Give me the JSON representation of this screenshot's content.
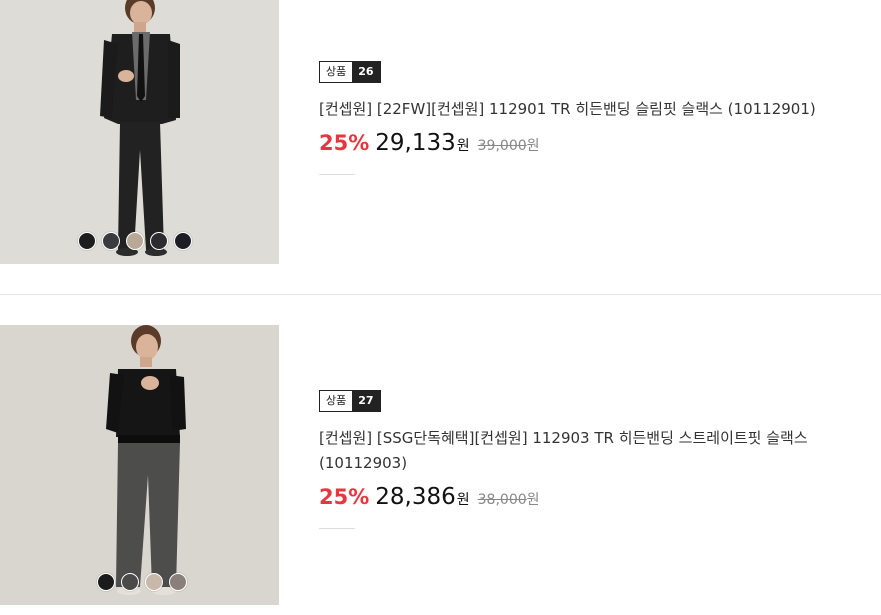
{
  "products": [
    {
      "badge_label": "상품",
      "badge_num": "26",
      "title": "[컨셉원] [22FW][컨셉원] 112901 TR 히든밴딩 슬림핏 슬랙스 (10112901)",
      "discount": "25%",
      "price": "29,133",
      "price_unit": "원",
      "original_price": "39,000",
      "original_unit": "원",
      "swatch_colors": [
        "#1d1d1d",
        "#3a3b3f",
        "#b9a898",
        "#2b2b30",
        "#1c1e26"
      ]
    },
    {
      "badge_label": "상품",
      "badge_num": "27",
      "title": "[컨셉원] [SSG단독혜택][컨셉원] 112903 TR 히든밴딩 스트레이트핏 슬랙스 (10112903)",
      "discount": "25%",
      "price": "28,386",
      "price_unit": "원",
      "original_price": "38,000",
      "original_unit": "원",
      "swatch_colors": [
        "#1b1b1b",
        "#4a4a48",
        "#c8b8aa",
        "#8a7f7a"
      ]
    }
  ],
  "colors": {
    "discount": "#e8363e",
    "badge_dark": "#222222"
  }
}
